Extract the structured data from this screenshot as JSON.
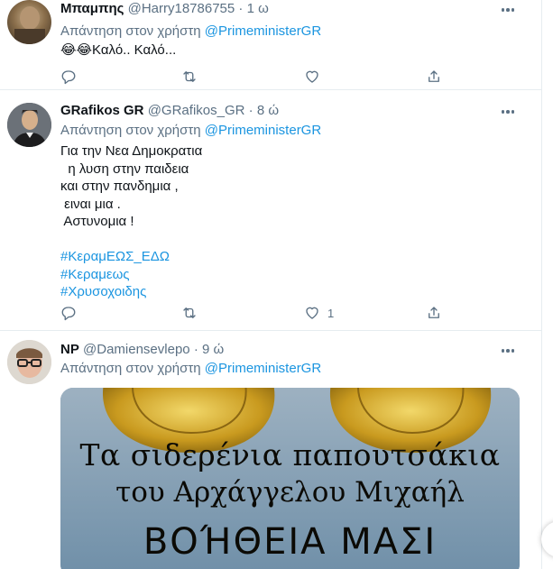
{
  "tweets": [
    {
      "name": "Μπαμπης",
      "handle": "@Harry18786755",
      "dot": "·",
      "time": "1 ω",
      "reply_prefix": "Απάντηση στον χρήστη",
      "reply_mention": "@PrimeministerGR",
      "text": "😂😂Καλό.. Καλό...",
      "likes": ""
    },
    {
      "name": "GRafikos GR",
      "handle": "@GRafikos_GR",
      "dot": "·",
      "time": "8 ώ",
      "reply_prefix": "Απάντηση στον χρήστη",
      "reply_mention": "@PrimeministerGR",
      "lines": [
        "Για την Νεα Δημοκρατια",
        "  η λυση στην παιδεια",
        "και στην πανδημια ,",
        " ειναι μια .",
        " Αστυνομια !"
      ],
      "hashtags": [
        "#ΚεραμΕΩΣ_ΕΔΩ",
        "#Κεραμεως",
        "#Χρυσοχοιδης"
      ],
      "likes": "1"
    },
    {
      "name": "NP",
      "handle": "@Damiensevlepo",
      "dot": "·",
      "time": "9 ώ",
      "reply_prefix": "Απάντηση στον χρήστη",
      "reply_mention": "@PrimeministerGR",
      "image_caption": [
        "Τα σιδερένια παπουτσάκια",
        "του Αρχάγγελου Μιχαήλ",
        "ΒΟΉΘΕΙΑ ΜΑΣΙ"
      ]
    }
  ],
  "colors": {
    "accent": "#1b95e0",
    "muted": "#5b7083",
    "border": "#e6ecf0"
  },
  "icons": [
    "more-icon",
    "reply-icon",
    "retweet-icon",
    "like-icon",
    "share-icon"
  ]
}
